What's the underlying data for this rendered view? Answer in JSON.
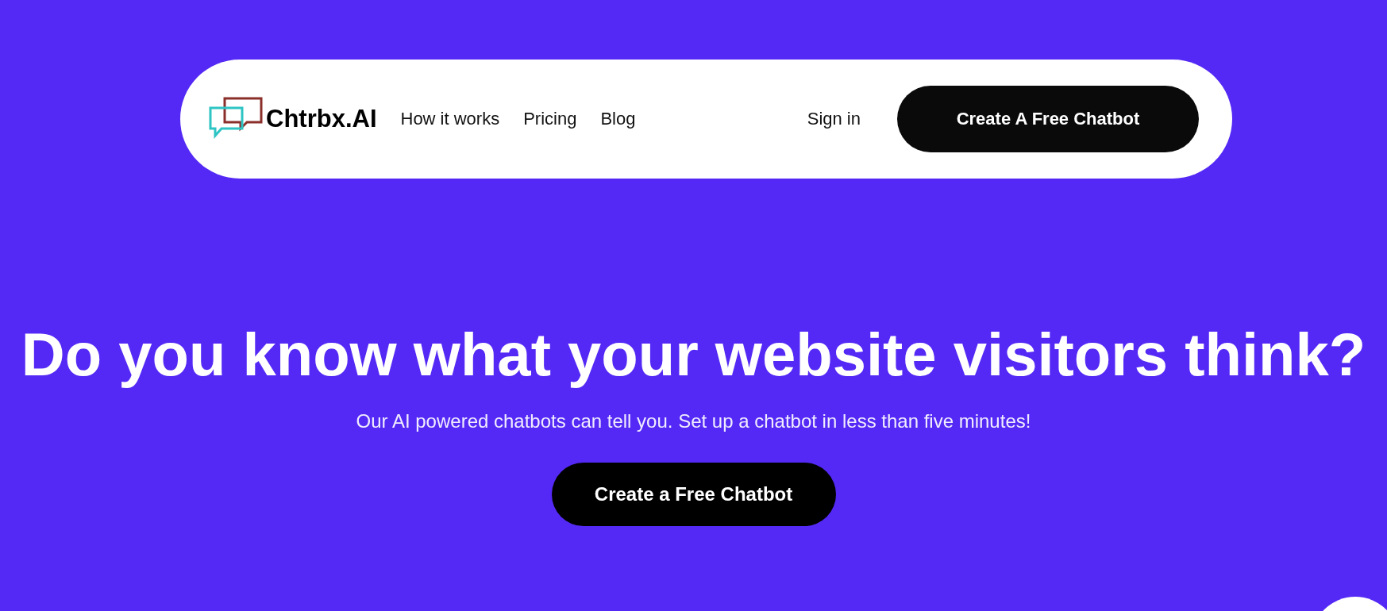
{
  "nav": {
    "brand": "Chtrbx.AI",
    "links": [
      "How it works",
      "Pricing",
      "Blog"
    ],
    "sign_in": "Sign in",
    "cta": "Create A Free Chatbot"
  },
  "hero": {
    "heading": "Do you know what your website visitors think?",
    "subtitle": "Our AI powered chatbots can tell you. Set up a chatbot in less than five minutes!",
    "cta": "Create a Free Chatbot"
  }
}
